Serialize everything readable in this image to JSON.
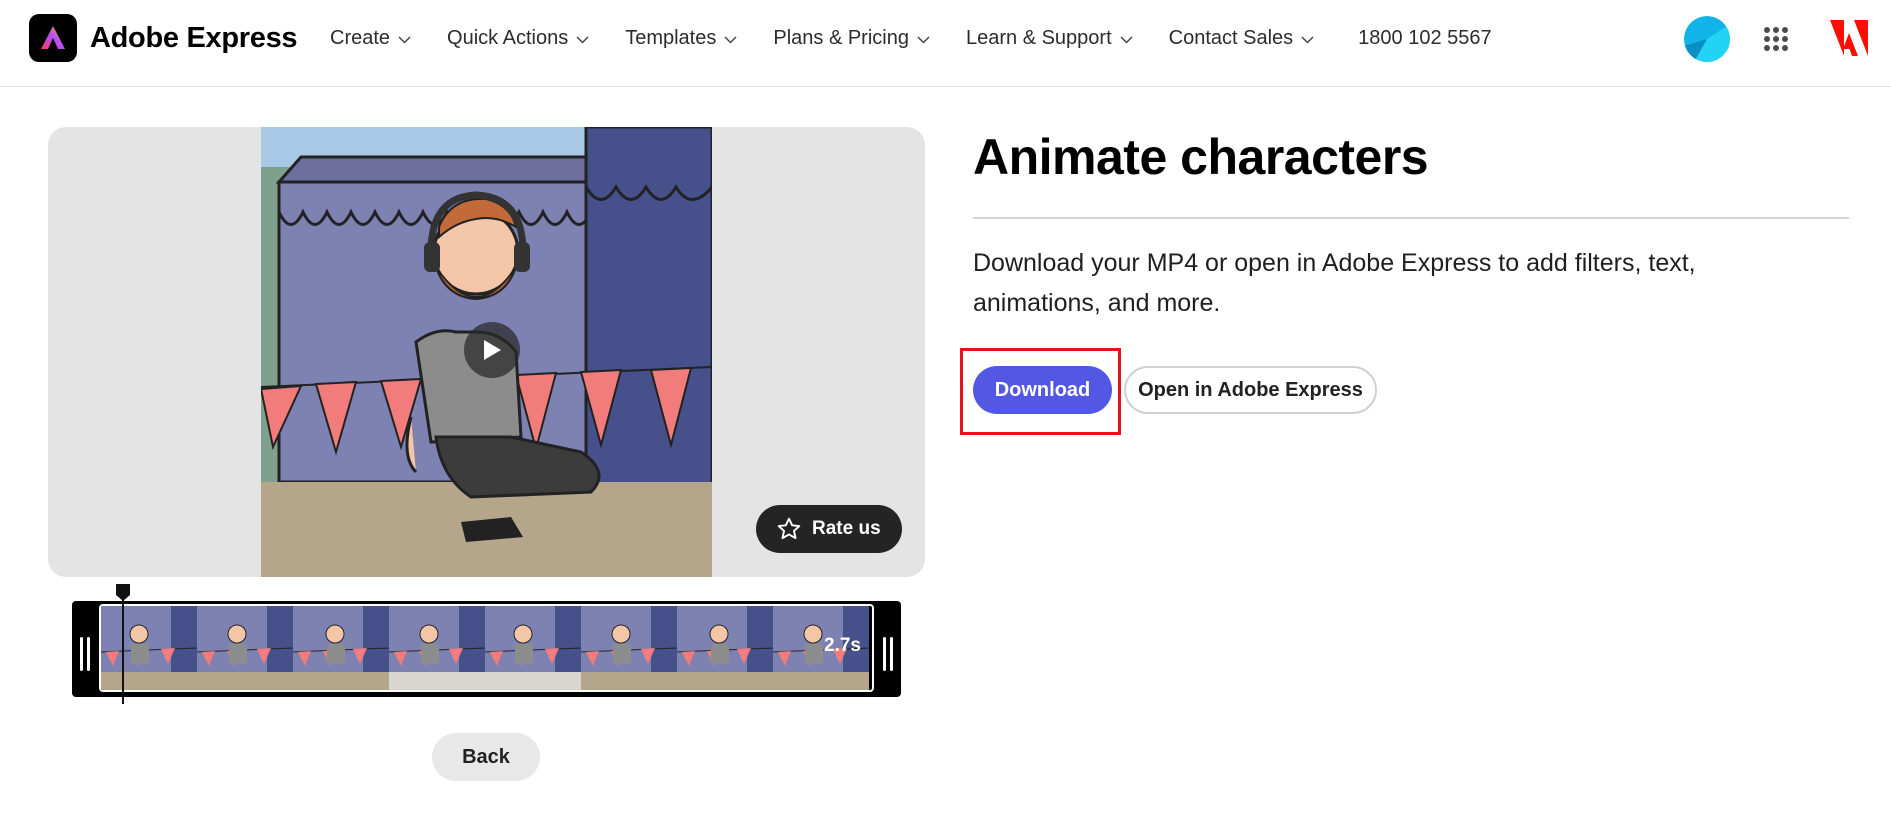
{
  "header": {
    "brand": "Adobe Express",
    "nav": [
      {
        "label": "Create"
      },
      {
        "label": "Quick Actions"
      },
      {
        "label": "Templates"
      },
      {
        "label": "Plans & Pricing"
      },
      {
        "label": "Learn & Support"
      },
      {
        "label": "Contact Sales"
      }
    ],
    "phone": "1800 102 5567",
    "icons": {
      "apps": "apps-grid-icon",
      "adobe": "adobe-logo-icon",
      "chevron": "chevron-down-icon"
    }
  },
  "preview": {
    "rate_label": "Rate us",
    "timeline_duration": "2.7s",
    "back_label": "Back"
  },
  "content": {
    "title": "Animate characters",
    "description": "Download your MP4 or open in Adobe Express to add filters, text, animations, and more.",
    "download_label": "Download",
    "open_label": "Open in Adobe Express"
  },
  "colors": {
    "primary_button": "#5258e4",
    "highlight": "#e3141b",
    "adobe_red": "#fa0f00"
  }
}
